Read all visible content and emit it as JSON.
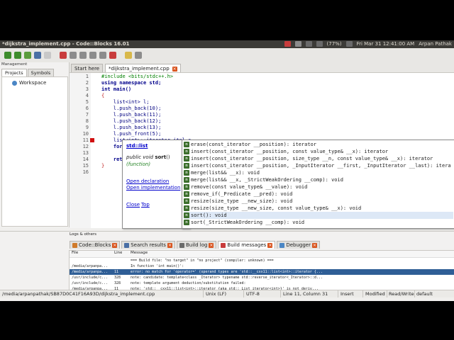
{
  "window": {
    "title": "*dijkstra_implement.cpp - Code::Blocks 16.01",
    "battery": "(77%)",
    "clock": "Fri Mar 31 12:41:00 AM",
    "user": "Arpan Pathak"
  },
  "management": {
    "title": "Management",
    "tabs": [
      "Projects",
      "Symbols"
    ],
    "workspace": "Workspace"
  },
  "editor_tabs": [
    "Start here",
    "*dijkstra_implement.cpp"
  ],
  "code": {
    "line_numbers": [
      "1",
      "2",
      "3",
      "4",
      "5",
      "6",
      "7",
      "8",
      "9",
      "10",
      "11",
      "12",
      "13",
      "14",
      "15",
      "16"
    ],
    "lines": [
      "#include <bits/stdc++.h>",
      "using namespace std;",
      "int main()",
      "{",
      "    list<int> l;",
      "    l.push_back(10);",
      "    l.push_back(11);",
      "    l.push_back(12);",
      "    l.push_back(13);",
      "    l.push_front(5);",
      "    list<int>::iterator it=l.s",
      "    for",
      "",
      "    ret",
      "}",
      ""
    ]
  },
  "doc_popup": {
    "class": "std::list",
    "signature_pre": "public void ",
    "signature_fn": "sort",
    "signature_post": "()",
    "kind": "(function)",
    "links": [
      "Open declaration",
      "Open implementation",
      "Close",
      "Top"
    ]
  },
  "completion": {
    "items": [
      "erase(const_iterator __position): iterator",
      "insert(const_iterator __position, const value_type& __x): iterator",
      "insert(const_iterator __position, size_type __n, const value_type& __x): iterator",
      "insert(const_iterator __position, _InputIterator __first, _InputIterator __last): itera",
      "merge(list&& __x): void",
      "merge(list&& __x, _StrictWeakOrdering __comp): void",
      "remove(const value_type& __value): void",
      "remove_if(_Predicate __pred): void",
      "resize(size_type __new_size): void",
      "resize(size_type __new_size, const value_type& __x): void",
      "sort(): void",
      "sort(_StrictWeakOrdering __comp): void"
    ],
    "selected_index": 10
  },
  "logs": {
    "title": "Logs & others",
    "tabs": [
      "Code::Blocks",
      "Search results",
      "Build log",
      "Build messages",
      "Debugger"
    ],
    "columns": [
      "File",
      "Line",
      "Message"
    ],
    "rows": [
      {
        "file": "",
        "line": "",
        "message": "=== Build file: \"no target\" in \"no project\" (compiler: unknown) ==="
      },
      {
        "file": "/media/arpanpa...",
        "line": "",
        "message": "In function 'int main()':"
      },
      {
        "file": "/media/arpanpa...",
        "line": "11",
        "message": "error: no match for 'operator=' (operand types are 'std::__cxx11::list<int>::iterator {..."
      },
      {
        "file": "/usr/include/c...",
        "line": "328",
        "message": "note: candidate: template<class _Iterator> typename std::reverse_iterator<_Iterator>::d..."
      },
      {
        "file": "/usr/include/c...",
        "line": "328",
        "message": "note:   template argument deduction/substitution failed:"
      },
      {
        "file": "/media/arpanpa...",
        "line": "11",
        "message": "note:   'std::__cxx11::list<int>::iterator {aka std::_List_iterator<int>}' is not deriv..."
      }
    ],
    "selected_index": 2
  },
  "statusbar": {
    "path": "/media/arpanpathak/SB87D0C41F16A93D/dijkstra_implement.cpp",
    "eol": "Unix (LF)",
    "encoding": "UTF-8",
    "position": "Line 11, Column 31",
    "mode": "Insert",
    "modified": "Modified",
    "access": "Read/Write",
    "profile": "default"
  },
  "colors": {
    "menubar": "#3c3b37",
    "keyword": "#00008b",
    "preprocessor": "#008000",
    "number": "#f000f0",
    "selection": "#2f5e96",
    "close_button": "#d9541e"
  }
}
